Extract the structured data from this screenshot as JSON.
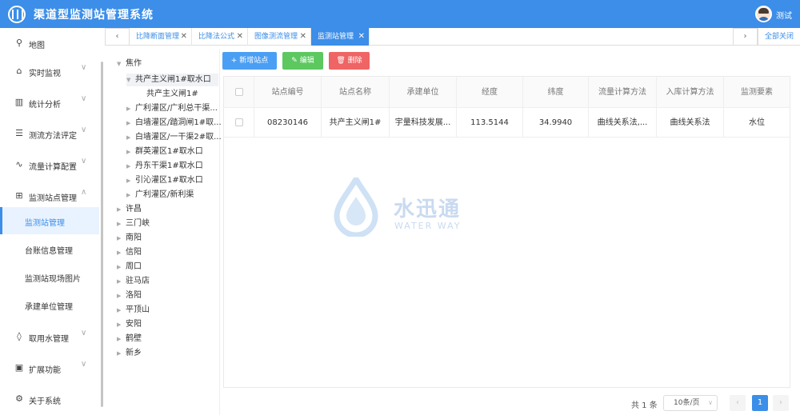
{
  "header": {
    "title": "渠道型监测站管理系统",
    "user": "测试"
  },
  "sidebar": {
    "items": [
      {
        "label": "地图",
        "icon": "location-pin-icon",
        "glyph": "⚲"
      },
      {
        "label": "实时监视",
        "icon": "monitor-icon",
        "glyph": "⌂"
      },
      {
        "label": "统计分析",
        "icon": "bar-chart-icon",
        "glyph": "▥"
      },
      {
        "label": "测流方法评定",
        "icon": "list-icon",
        "glyph": "☰"
      },
      {
        "label": "流量计算配置",
        "icon": "pulse-icon",
        "glyph": "∿"
      },
      {
        "label": "监测站点管理",
        "icon": "grid-icon",
        "glyph": "⊞"
      },
      {
        "label": "取用水管理",
        "icon": "water-drop-icon",
        "glyph": "◊"
      },
      {
        "label": "扩展功能",
        "icon": "image-icon",
        "glyph": "▣"
      },
      {
        "label": "关于系统",
        "icon": "gear-icon",
        "glyph": "⚙"
      }
    ],
    "submenu": [
      "监测站管理",
      "台账信息管理",
      "监测站现场图片",
      "承建单位管理"
    ]
  },
  "tabs": [
    {
      "label": "比降断面管理"
    },
    {
      "label": "比降法公式"
    },
    {
      "label": "图像测流管理"
    },
    {
      "label": "监测站管理"
    }
  ],
  "tabs_close_all": "全部关闭",
  "tree": {
    "root": "焦作",
    "selected": "共产主义闸1#取水口",
    "selected_child": "共产主义闸1#",
    "children": [
      "广利灌区/广利总干渠...",
      "白墙灌区/踏洞闸1#取...",
      "白墙灌区/一干渠2#取...",
      "群英灌区1#取水口",
      "丹东干渠1#取水口",
      "引沁灌区1#取水口",
      "广利灌区/新利渠"
    ],
    "others": [
      "许昌",
      "三门峡",
      "南阳",
      "信阳",
      "周口",
      "驻马店",
      "洛阳",
      "平顶山",
      "安阳",
      "鹤壁",
      "新乡"
    ]
  },
  "toolbar": {
    "add": "+ 新增站点",
    "edit": "编辑",
    "delete": "删除"
  },
  "table": {
    "columns": [
      "站点编号",
      "站点名称",
      "承建单位",
      "经度",
      "纬度",
      "流量计算方法",
      "入库计算方法",
      "监测要素"
    ],
    "rows": [
      [
        "08230146",
        "共产主义闸1#",
        "宇量科技发展...",
        "113.5144",
        "34.9940",
        "曲线关系法,...",
        "曲线关系法",
        "水位"
      ]
    ]
  },
  "watermark": {
    "cn": "水迅通",
    "en": "WATER WAY"
  },
  "pagination": {
    "total": "共 1 条",
    "page_size": "10条/页",
    "current_page": "1"
  },
  "colors": {
    "primary": "#3c8ee8",
    "add": "#4a9ff5",
    "edit": "#5cc85f",
    "delete": "#ef6464"
  }
}
